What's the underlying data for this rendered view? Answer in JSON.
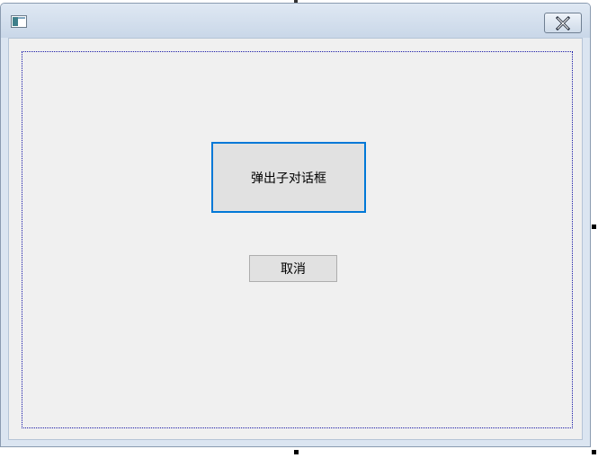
{
  "window": {
    "title": "",
    "icon": "app-window-icon",
    "close_icon": "close-icon"
  },
  "buttons": {
    "open_child_dialog": "弹出子对话框",
    "cancel": "取消"
  }
}
